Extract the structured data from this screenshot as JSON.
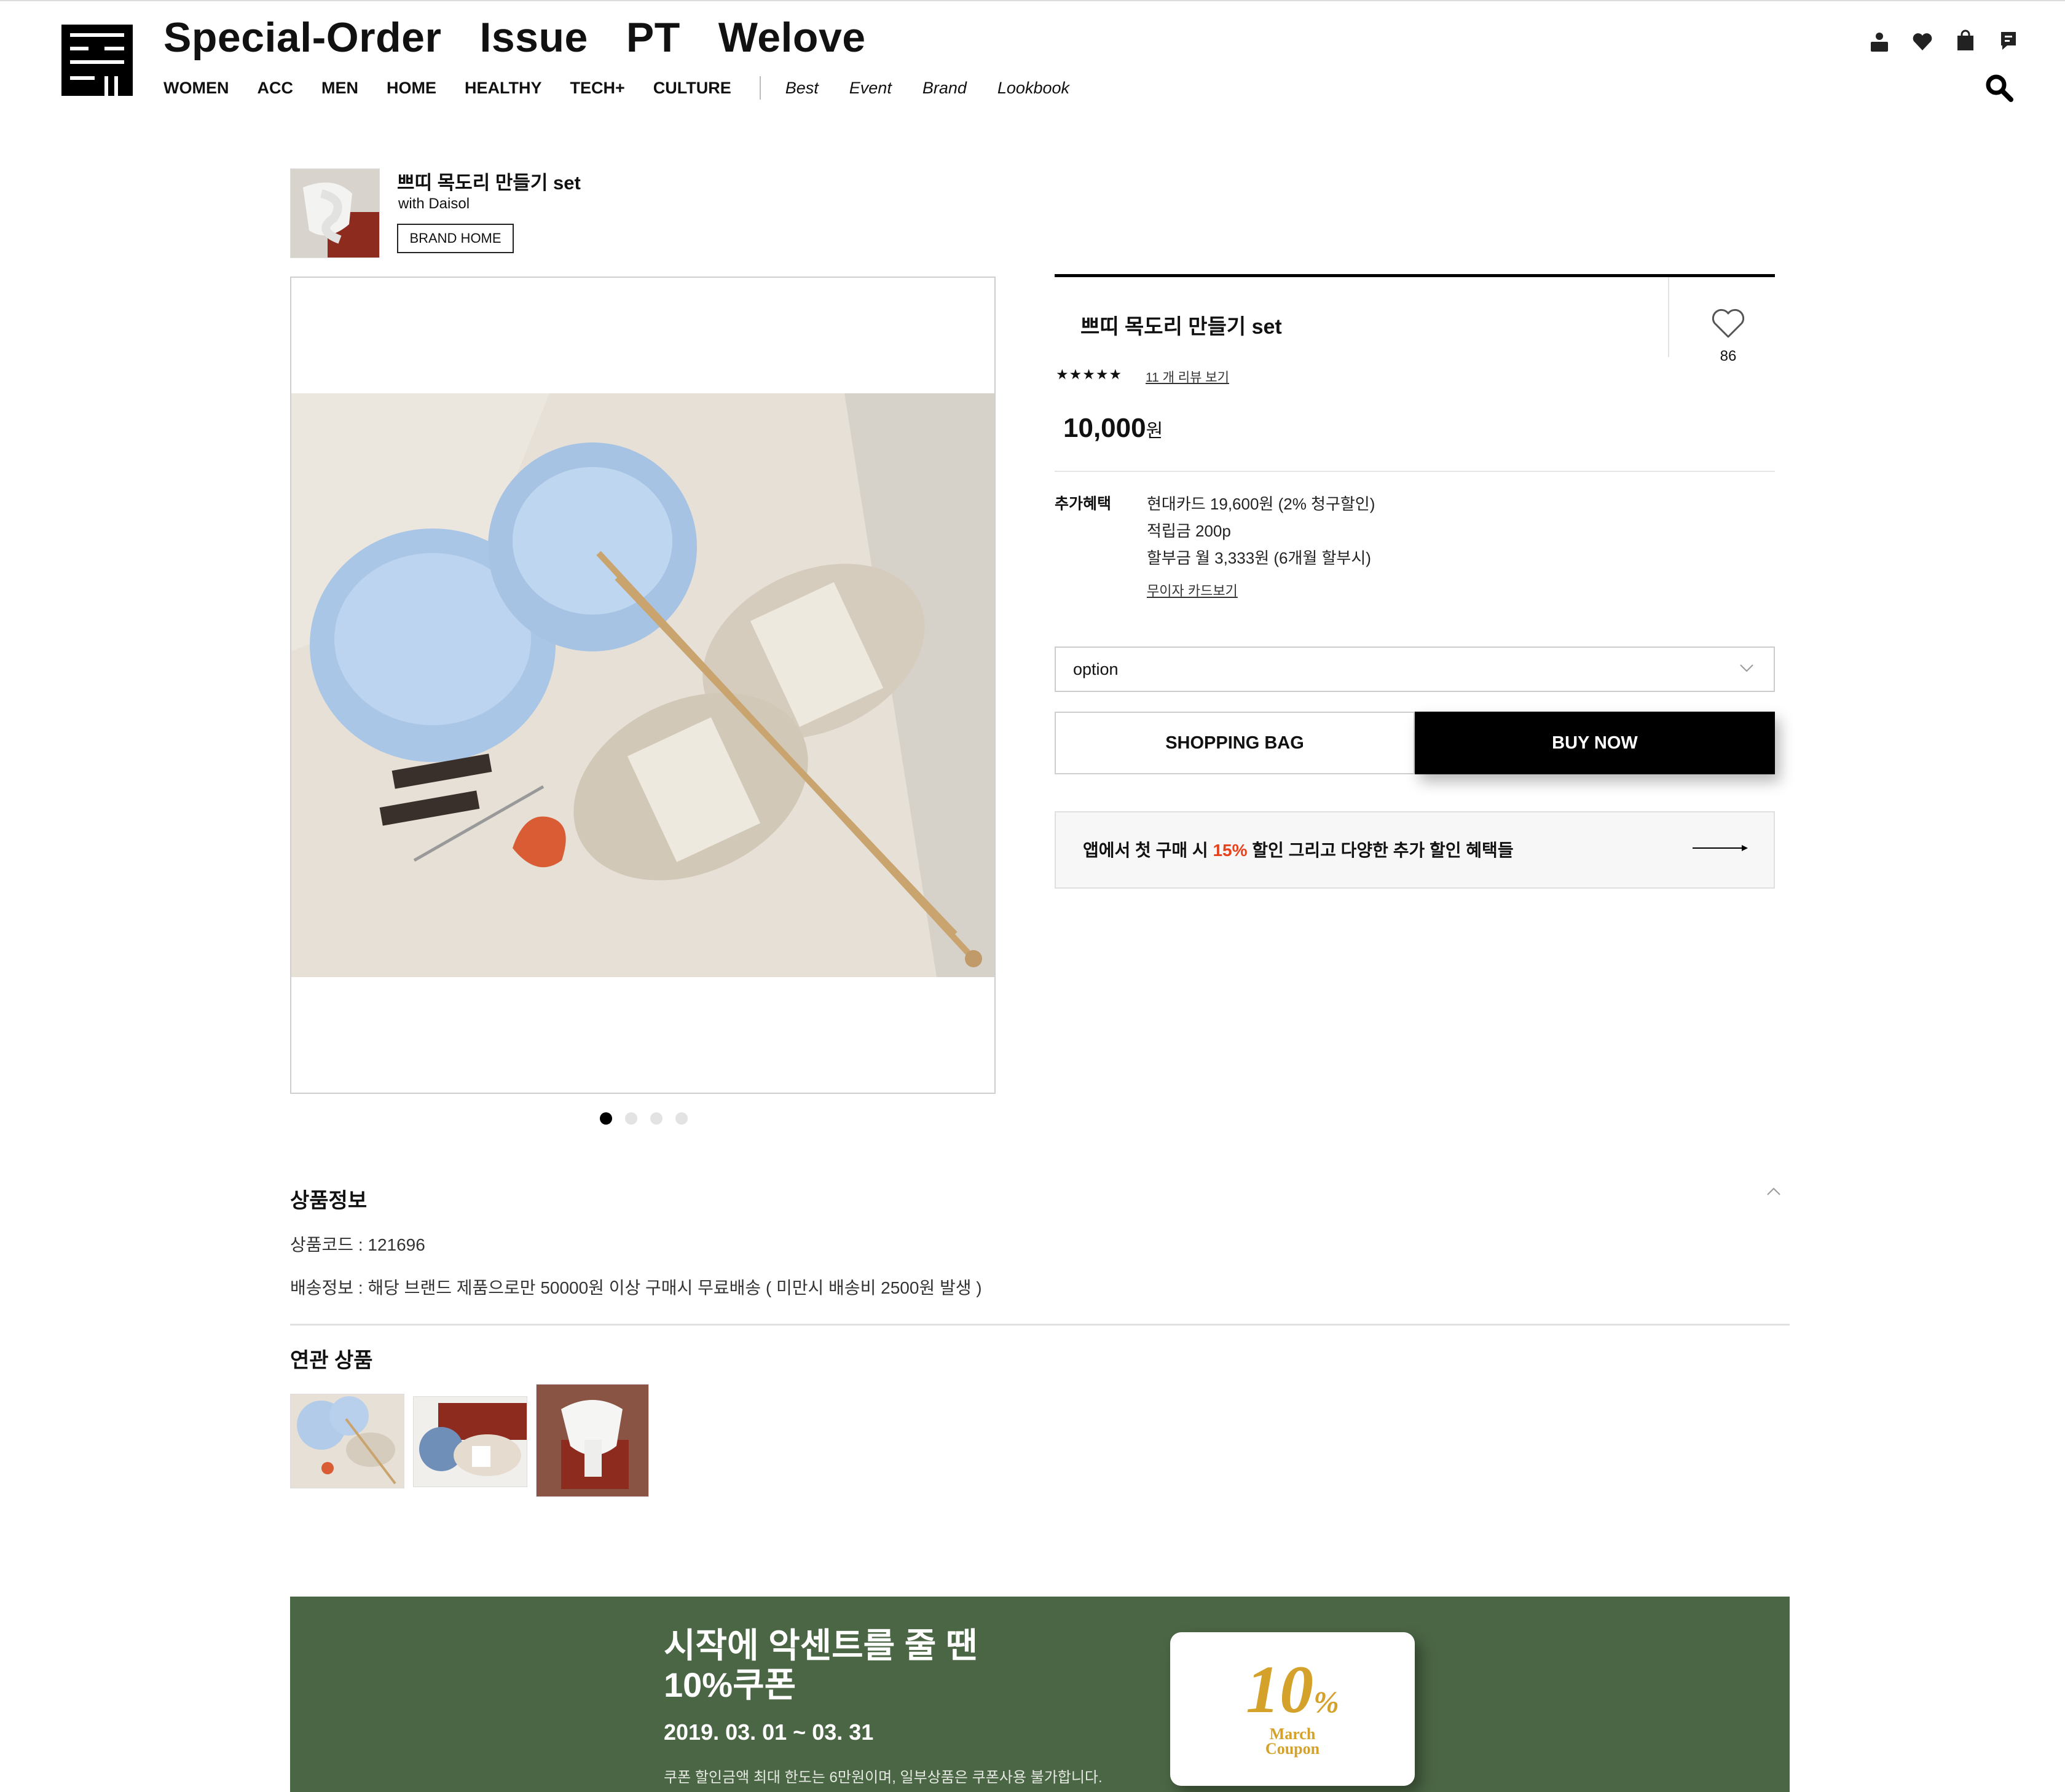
{
  "header": {
    "main_nav": [
      "Special-Order",
      "Issue",
      "PT",
      "Welove"
    ],
    "categories": [
      "WOMEN",
      "ACC",
      "MEN",
      "HOME",
      "HEALTHY",
      "TECH+",
      "CULTURE"
    ],
    "featured": [
      "Best",
      "Event",
      "Brand",
      "Lookbook"
    ],
    "icons": [
      "user-icon",
      "heart-icon",
      "shopping-bag-icon",
      "message-icon",
      "search-icon"
    ]
  },
  "brand": {
    "title": "쁘띠 목도리 만들기 set",
    "with": "with Daisol",
    "home_button": "BRAND HOME"
  },
  "gallery": {
    "slide_count": 4,
    "active_slide": 1
  },
  "product": {
    "name": "쁘띠 목도리 만들기 set",
    "likes": "86",
    "stars": "★★★★★",
    "rating": 5,
    "review_link": "11 개 리뷰 보기",
    "price": "10,000",
    "currency": "원",
    "benefit_label": "추가혜택",
    "benefits": [
      "현대카드 19,600원 (2% 청구할인)",
      "적립금 200p",
      "할부금 월 3,333원 (6개월 할부시)"
    ],
    "card_link": "무이자 카드보기",
    "option_placeholder": "option",
    "shopping_bag": "SHOPPING BAG",
    "buy_now": "BUY NOW"
  },
  "promo": {
    "before": "앱에서 첫 구매 시 ",
    "percent": "15%",
    "after": " 할인 그리고 다양한 추가 할인 혜택들",
    "accent_color": "#e8411b"
  },
  "info": {
    "title": "상품정보",
    "code": "상품코드 : 121696",
    "shipping": "배송정보 : 해당 브랜드 제품으로만 50000원 이상 구매시 무료배송 ( 미만시 배송비 2500원 발생 )"
  },
  "related": {
    "title": "연관 상품",
    "count": 3
  },
  "banner": {
    "line1": "시작에 악센트를 줄 땐",
    "line2": "10%쿠폰",
    "date": "2019. 03. 01 ~ 03. 31",
    "note": "쿠폰 할인금액 최대 한도는 6만원이며, 일부상품은 쿠폰사용 불가합니다.",
    "coupon_big": "10",
    "coupon_pct": "%",
    "coupon_w1": "March",
    "coupon_w2": "Coupon",
    "bg_color": "#4b6645",
    "coupon_color": "#d4a22a"
  }
}
